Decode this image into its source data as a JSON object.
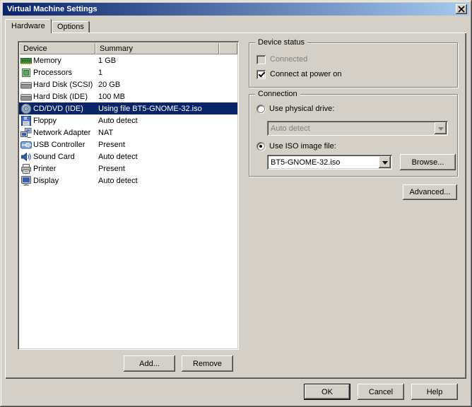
{
  "window": {
    "title": "Virtual Machine Settings"
  },
  "tabs": [
    {
      "label": "Hardware",
      "active": true
    },
    {
      "label": "Options",
      "active": false
    }
  ],
  "device_list": {
    "columns": [
      "Device",
      "Summary"
    ],
    "rows": [
      {
        "icon": "memory-icon",
        "device": "Memory",
        "summary": "1 GB",
        "selected": false
      },
      {
        "icon": "processor-icon",
        "device": "Processors",
        "summary": "1",
        "selected": false
      },
      {
        "icon": "hard-disk-icon",
        "device": "Hard Disk (SCSI)",
        "summary": "20 GB",
        "selected": false
      },
      {
        "icon": "hard-disk-icon",
        "device": "Hard Disk (IDE)",
        "summary": "100 MB",
        "selected": false
      },
      {
        "icon": "cd-dvd-icon",
        "device": "CD/DVD (IDE)",
        "summary": "Using file BT5-GNOME-32.iso",
        "selected": true
      },
      {
        "icon": "floppy-icon",
        "device": "Floppy",
        "summary": "Auto detect",
        "selected": false
      },
      {
        "icon": "network-adapter-icon",
        "device": "Network Adapter",
        "summary": "NAT",
        "selected": false
      },
      {
        "icon": "usb-controller-icon",
        "device": "USB Controller",
        "summary": "Present",
        "selected": false
      },
      {
        "icon": "sound-card-icon",
        "device": "Sound Card",
        "summary": "Auto detect",
        "selected": false
      },
      {
        "icon": "printer-icon",
        "device": "Printer",
        "summary": "Present",
        "selected": false
      },
      {
        "icon": "display-icon",
        "device": "Display",
        "summary": "Auto detect",
        "selected": false
      }
    ]
  },
  "device_status": {
    "label": "Device status",
    "connected": {
      "label": "Connected",
      "checked": false,
      "enabled": false
    },
    "connect_at_power_on": {
      "label": "Connect at power on",
      "checked": true,
      "enabled": true
    }
  },
  "connection": {
    "label": "Connection",
    "use_physical_drive": {
      "label": "Use physical drive:",
      "selected": false
    },
    "physical_drive_value": "Auto detect",
    "use_iso_image": {
      "label": "Use ISO image file:",
      "selected": true
    },
    "iso_value": "BT5-GNOME-32.iso"
  },
  "buttons": {
    "browse": "Browse...",
    "advanced": "Advanced...",
    "add": "Add...",
    "remove": "Remove",
    "ok": "OK",
    "cancel": "Cancel",
    "help": "Help"
  },
  "colors": {
    "dialog_bg": "#D4D0C8",
    "titlebar_gradient_start": "#0A246A",
    "titlebar_gradient_end": "#A6CAF0",
    "selection_bg": "#0A246A",
    "selection_text": "#FFFFFF",
    "disabled_text": "#808080"
  }
}
